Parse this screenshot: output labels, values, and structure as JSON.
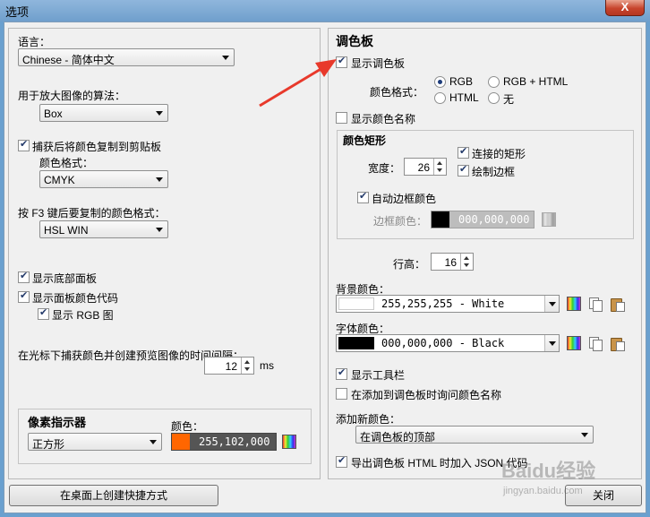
{
  "window": {
    "title": "选项",
    "close_glyph": "X"
  },
  "left": {
    "language_label": "语言：",
    "language_value": "Chinese - 简体中文",
    "zoom_algo_label": "用于放大图像的算法：",
    "zoom_algo_value": "Box",
    "copy_on_capture_label": "捕获后将颜色复制到剪贴板",
    "copy_on_capture_checked": true,
    "copy_format_label": "颜色格式：",
    "copy_format_value": "CMYK",
    "f3_format_label": "按 F3 键后要复制的颜色格式：",
    "f3_format_value": "HSL WIN",
    "show_bottom_panel_label": "显示底部面板",
    "show_bottom_panel_checked": true,
    "show_panel_codes_label": "显示面板颜色代码",
    "show_panel_codes_checked": true,
    "show_rgb_chart_label": "显示 RGB 图",
    "show_rgb_chart_checked": true,
    "capture_interval_label": "在光标下捕获颜色并创建预览图像的时间间隔：",
    "capture_interval_value": "12",
    "capture_interval_unit": "ms",
    "pixel_indicator": {
      "title": "像素指示器",
      "shape_value": "正方形",
      "color_label": "颜色：",
      "color_value": "255,102,000",
      "color_hex": "#ff6600"
    },
    "create_shortcut_label": "在桌面上创建快捷方式"
  },
  "right": {
    "title": "调色板",
    "show_palette_label": "显示调色板",
    "show_palette_checked": true,
    "color_format_label": "颜色格式：",
    "formats": [
      {
        "label": "RGB",
        "selected": true
      },
      {
        "label": "RGB + HTML",
        "selected": false
      },
      {
        "label": "HTML",
        "selected": false
      },
      {
        "label": "无",
        "selected": false
      }
    ],
    "show_color_names_label": "显示颜色名称",
    "show_color_names_checked": false,
    "rect": {
      "title": "颜色矩形",
      "width_label": "宽度：",
      "width_value": "26",
      "connected_label": "连接的矩形",
      "connected_checked": true,
      "draw_border_label": "绘制边框",
      "draw_border_checked": true,
      "auto_border_label": "自动边框颜色",
      "auto_border_checked": true,
      "border_color_label": "边框颜色：",
      "border_color_value": "000,000,000",
      "border_color_hex": "#000000"
    },
    "row_height_label": "行高：",
    "row_height_value": "16",
    "bg_color_label": "背景颜色：",
    "bg_color_value": "255,255,255 - White",
    "bg_color_hex": "#ffffff",
    "font_color_label": "字体颜色：",
    "font_color_value": "000,000,000 - Black",
    "font_color_hex": "#000000",
    "show_toolbar_label": "显示工具栏",
    "show_toolbar_checked": true,
    "ask_name_label": "在添加到调色板时询问颜色名称",
    "ask_name_checked": false,
    "add_new_color_label": "添加新颜色：",
    "add_new_color_value": "在调色板的顶部",
    "export_json_label": "导出调色板 HTML 时加入 JSON 代码",
    "export_json_checked": true,
    "close_label": "关闭"
  },
  "watermark": {
    "text": "Baidu经验",
    "sub": "jingyan.baidu.com"
  },
  "annotation": {
    "arrow_color": "#e8392b"
  }
}
